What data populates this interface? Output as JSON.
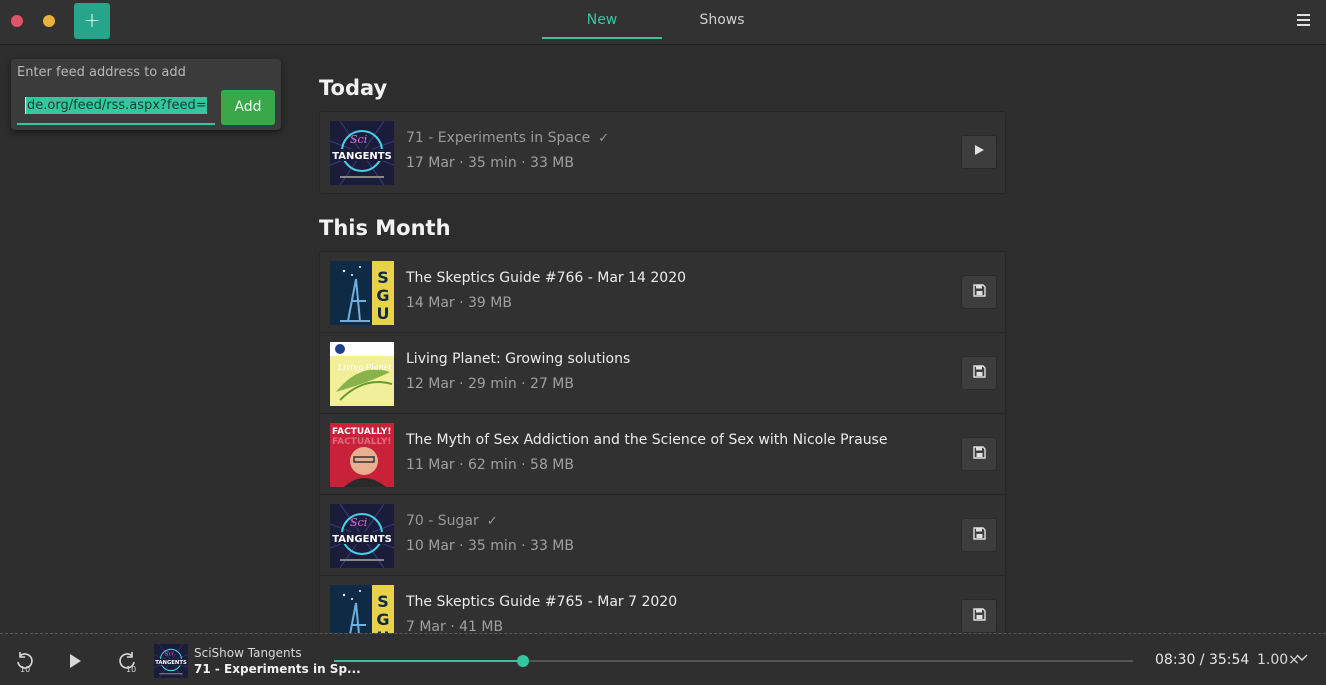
{
  "header": {
    "tabs": [
      {
        "label": "New",
        "active": true
      },
      {
        "label": "Shows",
        "active": false
      }
    ],
    "add_icon": "plus-icon",
    "menu_icon": "hamburger-icon",
    "accent_color": "#33c7a0"
  },
  "add_feed": {
    "label": "Enter feed address to add",
    "value": "de.org/feed/rss.aspx?feed=sgu",
    "button": "Add"
  },
  "sections": [
    {
      "title": "Today",
      "episodes": [
        {
          "title": "71 - Experiments in Space",
          "played": true,
          "meta": "17 Mar · 35 min · 33 MB",
          "action": "play-icon",
          "show": "tangents"
        }
      ]
    },
    {
      "title": "This Month",
      "episodes": [
        {
          "title": "The Skeptics Guide #766 - Mar 14 2020",
          "played": false,
          "meta": "14 Mar · 39 MB",
          "action": "save-icon",
          "show": "sgu"
        },
        {
          "title": "Living Planet: Growing solutions",
          "played": false,
          "meta": "12 Mar · 29 min · 27 MB",
          "action": "save-icon",
          "show": "livingplanet"
        },
        {
          "title": "The Myth of Sex Addiction and the Science of Sex with Nicole Prause",
          "played": false,
          "meta": "11 Mar · 62 min · 58 MB",
          "action": "save-icon",
          "show": "factually"
        },
        {
          "title": "70 - Sugar",
          "played": true,
          "meta": "10 Mar · 35 min · 33 MB",
          "action": "save-icon",
          "show": "tangents"
        },
        {
          "title": "The Skeptics Guide #765 - Mar 7 2020",
          "played": false,
          "meta": "7 Mar · 41 MB",
          "action": "save-icon",
          "show": "sgu"
        }
      ]
    }
  ],
  "player": {
    "show": "SciShow Tangents",
    "episode": "71 - Experiments in Sp...",
    "time": "08:30 / 35:54",
    "rate": "1.00×",
    "progress": 0.237,
    "controls": [
      "rewind-10-icon",
      "play-icon",
      "forward-10-icon"
    ]
  }
}
